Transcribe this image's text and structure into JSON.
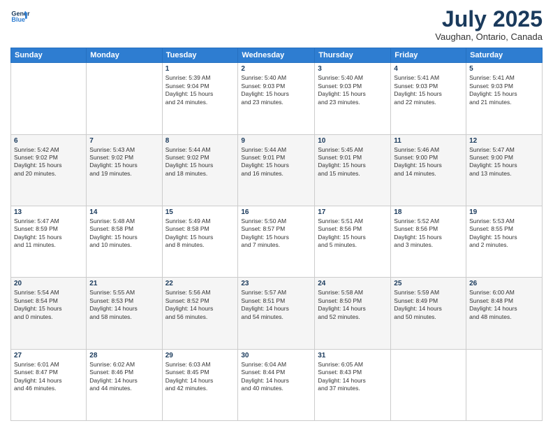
{
  "header": {
    "logo_line1": "General",
    "logo_line2": "Blue",
    "month": "July 2025",
    "location": "Vaughan, Ontario, Canada"
  },
  "days_of_week": [
    "Sunday",
    "Monday",
    "Tuesday",
    "Wednesday",
    "Thursday",
    "Friday",
    "Saturday"
  ],
  "weeks": [
    [
      {
        "day": "",
        "info": ""
      },
      {
        "day": "",
        "info": ""
      },
      {
        "day": "1",
        "info": "Sunrise: 5:39 AM\nSunset: 9:04 PM\nDaylight: 15 hours\nand 24 minutes."
      },
      {
        "day": "2",
        "info": "Sunrise: 5:40 AM\nSunset: 9:03 PM\nDaylight: 15 hours\nand 23 minutes."
      },
      {
        "day": "3",
        "info": "Sunrise: 5:40 AM\nSunset: 9:03 PM\nDaylight: 15 hours\nand 23 minutes."
      },
      {
        "day": "4",
        "info": "Sunrise: 5:41 AM\nSunset: 9:03 PM\nDaylight: 15 hours\nand 22 minutes."
      },
      {
        "day": "5",
        "info": "Sunrise: 5:41 AM\nSunset: 9:03 PM\nDaylight: 15 hours\nand 21 minutes."
      }
    ],
    [
      {
        "day": "6",
        "info": "Sunrise: 5:42 AM\nSunset: 9:02 PM\nDaylight: 15 hours\nand 20 minutes."
      },
      {
        "day": "7",
        "info": "Sunrise: 5:43 AM\nSunset: 9:02 PM\nDaylight: 15 hours\nand 19 minutes."
      },
      {
        "day": "8",
        "info": "Sunrise: 5:44 AM\nSunset: 9:02 PM\nDaylight: 15 hours\nand 18 minutes."
      },
      {
        "day": "9",
        "info": "Sunrise: 5:44 AM\nSunset: 9:01 PM\nDaylight: 15 hours\nand 16 minutes."
      },
      {
        "day": "10",
        "info": "Sunrise: 5:45 AM\nSunset: 9:01 PM\nDaylight: 15 hours\nand 15 minutes."
      },
      {
        "day": "11",
        "info": "Sunrise: 5:46 AM\nSunset: 9:00 PM\nDaylight: 15 hours\nand 14 minutes."
      },
      {
        "day": "12",
        "info": "Sunrise: 5:47 AM\nSunset: 9:00 PM\nDaylight: 15 hours\nand 13 minutes."
      }
    ],
    [
      {
        "day": "13",
        "info": "Sunrise: 5:47 AM\nSunset: 8:59 PM\nDaylight: 15 hours\nand 11 minutes."
      },
      {
        "day": "14",
        "info": "Sunrise: 5:48 AM\nSunset: 8:58 PM\nDaylight: 15 hours\nand 10 minutes."
      },
      {
        "day": "15",
        "info": "Sunrise: 5:49 AM\nSunset: 8:58 PM\nDaylight: 15 hours\nand 8 minutes."
      },
      {
        "day": "16",
        "info": "Sunrise: 5:50 AM\nSunset: 8:57 PM\nDaylight: 15 hours\nand 7 minutes."
      },
      {
        "day": "17",
        "info": "Sunrise: 5:51 AM\nSunset: 8:56 PM\nDaylight: 15 hours\nand 5 minutes."
      },
      {
        "day": "18",
        "info": "Sunrise: 5:52 AM\nSunset: 8:56 PM\nDaylight: 15 hours\nand 3 minutes."
      },
      {
        "day": "19",
        "info": "Sunrise: 5:53 AM\nSunset: 8:55 PM\nDaylight: 15 hours\nand 2 minutes."
      }
    ],
    [
      {
        "day": "20",
        "info": "Sunrise: 5:54 AM\nSunset: 8:54 PM\nDaylight: 15 hours\nand 0 minutes."
      },
      {
        "day": "21",
        "info": "Sunrise: 5:55 AM\nSunset: 8:53 PM\nDaylight: 14 hours\nand 58 minutes."
      },
      {
        "day": "22",
        "info": "Sunrise: 5:56 AM\nSunset: 8:52 PM\nDaylight: 14 hours\nand 56 minutes."
      },
      {
        "day": "23",
        "info": "Sunrise: 5:57 AM\nSunset: 8:51 PM\nDaylight: 14 hours\nand 54 minutes."
      },
      {
        "day": "24",
        "info": "Sunrise: 5:58 AM\nSunset: 8:50 PM\nDaylight: 14 hours\nand 52 minutes."
      },
      {
        "day": "25",
        "info": "Sunrise: 5:59 AM\nSunset: 8:49 PM\nDaylight: 14 hours\nand 50 minutes."
      },
      {
        "day": "26",
        "info": "Sunrise: 6:00 AM\nSunset: 8:48 PM\nDaylight: 14 hours\nand 48 minutes."
      }
    ],
    [
      {
        "day": "27",
        "info": "Sunrise: 6:01 AM\nSunset: 8:47 PM\nDaylight: 14 hours\nand 46 minutes."
      },
      {
        "day": "28",
        "info": "Sunrise: 6:02 AM\nSunset: 8:46 PM\nDaylight: 14 hours\nand 44 minutes."
      },
      {
        "day": "29",
        "info": "Sunrise: 6:03 AM\nSunset: 8:45 PM\nDaylight: 14 hours\nand 42 minutes."
      },
      {
        "day": "30",
        "info": "Sunrise: 6:04 AM\nSunset: 8:44 PM\nDaylight: 14 hours\nand 40 minutes."
      },
      {
        "day": "31",
        "info": "Sunrise: 6:05 AM\nSunset: 8:43 PM\nDaylight: 14 hours\nand 37 minutes."
      },
      {
        "day": "",
        "info": ""
      },
      {
        "day": "",
        "info": ""
      }
    ]
  ]
}
